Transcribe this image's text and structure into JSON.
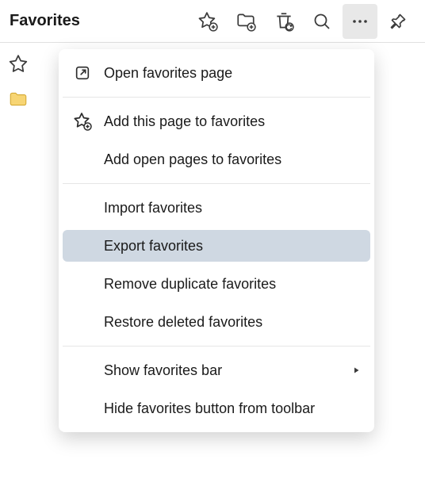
{
  "header": {
    "title": "Favorites"
  },
  "menu": {
    "open_page": "Open favorites page",
    "add_this": "Add this page to favorites",
    "add_open": "Add open pages to favorites",
    "import": "Import favorites",
    "export": "Export favorites",
    "remove_dup": "Remove duplicate favorites",
    "restore": "Restore deleted favorites",
    "show_bar": "Show favorites bar",
    "hide_btn": "Hide favorites button from toolbar"
  }
}
